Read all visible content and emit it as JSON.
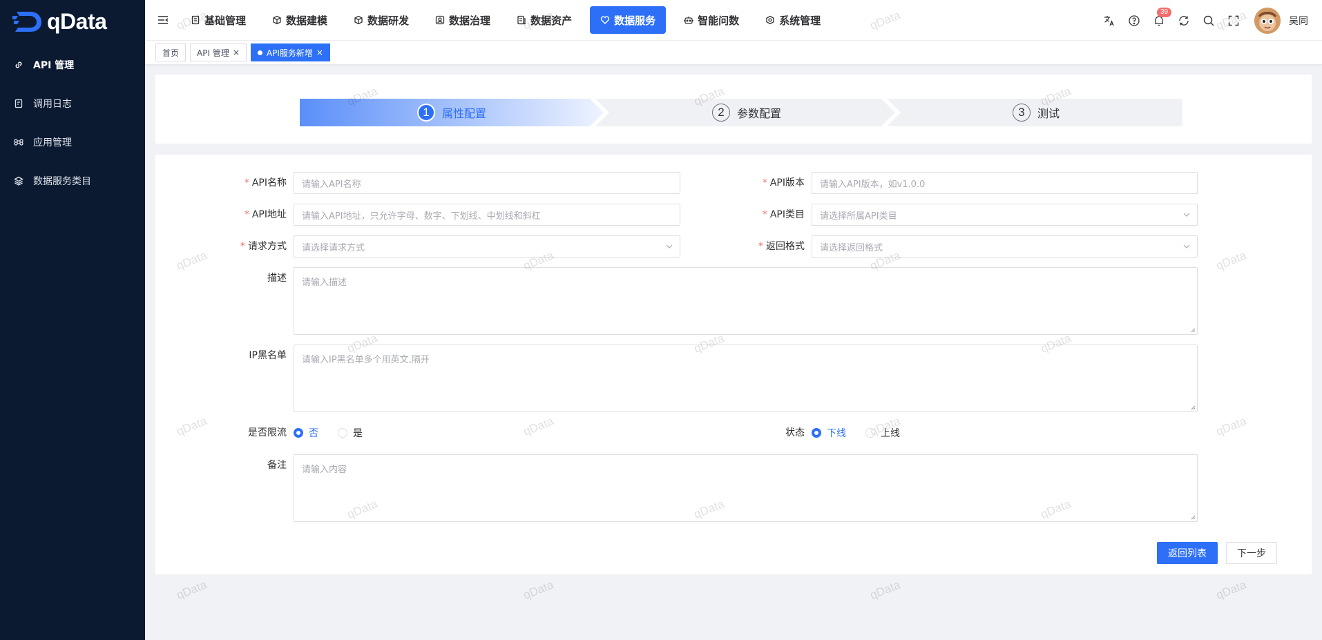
{
  "brand": {
    "name": "qData",
    "accent": "#2d6ff7",
    "sidebar_bg": "#0b1a31"
  },
  "sidebar": {
    "items": [
      {
        "label": "API 管理",
        "icon": "link-icon",
        "active": true
      },
      {
        "label": "调用日志",
        "icon": "log-icon"
      },
      {
        "label": "应用管理",
        "icon": "command-icon"
      },
      {
        "label": "数据服务类目",
        "icon": "layers-icon"
      }
    ]
  },
  "topnav": {
    "items": [
      {
        "label": "基础管理",
        "icon": "doc-icon"
      },
      {
        "label": "数据建模",
        "icon": "cube-icon"
      },
      {
        "label": "数据研发",
        "icon": "cube-outline-icon"
      },
      {
        "label": "数据治理",
        "icon": "governance-icon"
      },
      {
        "label": "数据资产",
        "icon": "asset-icon"
      },
      {
        "label": "数据服务",
        "icon": "heart-icon",
        "active": true
      },
      {
        "label": "智能问数",
        "icon": "robot-icon"
      },
      {
        "label": "系统管理",
        "icon": "settings-hex-icon"
      }
    ]
  },
  "header": {
    "notification_count": "39",
    "username": "吴同"
  },
  "tabs": [
    {
      "label": "首页"
    },
    {
      "label": "API 管理",
      "closable": true
    },
    {
      "label": "API服务新增",
      "closable": true,
      "active": true
    }
  ],
  "steps": [
    {
      "num": "1",
      "label": "属性配置",
      "active": true
    },
    {
      "num": "2",
      "label": "参数配置"
    },
    {
      "num": "3",
      "label": "测试"
    }
  ],
  "form": {
    "api_name": {
      "label": "API名称",
      "placeholder": "请输入API名称",
      "required": true
    },
    "api_version": {
      "label": "API版本",
      "placeholder": "请输入API版本，如v1.0.0",
      "required": true
    },
    "api_address": {
      "label": "API地址",
      "placeholder": "请输入API地址，只允许字母、数字、下划线、中划线和斜杠",
      "required": true
    },
    "api_category": {
      "label": "API类目",
      "placeholder": "请选择所属API类目",
      "required": true
    },
    "request_method": {
      "label": "请求方式",
      "placeholder": "请选择请求方式",
      "required": true
    },
    "return_format": {
      "label": "返回格式",
      "placeholder": "请选择返回格式",
      "required": true
    },
    "description": {
      "label": "描述",
      "placeholder": "请输入描述"
    },
    "ip_blacklist": {
      "label": "IP黑名单",
      "placeholder": "请输入IP黑名单多个用英文,隔开"
    },
    "rate_limit": {
      "label": "是否限流",
      "options": [
        "否",
        "是"
      ],
      "selected": "否"
    },
    "status": {
      "label": "状态",
      "options": [
        "下线",
        "上线"
      ],
      "selected": "下线"
    },
    "remark": {
      "label": "备注",
      "placeholder": "请输入内容"
    }
  },
  "buttons": {
    "back": "返回列表",
    "next": "下一步"
  },
  "watermark": "qData"
}
